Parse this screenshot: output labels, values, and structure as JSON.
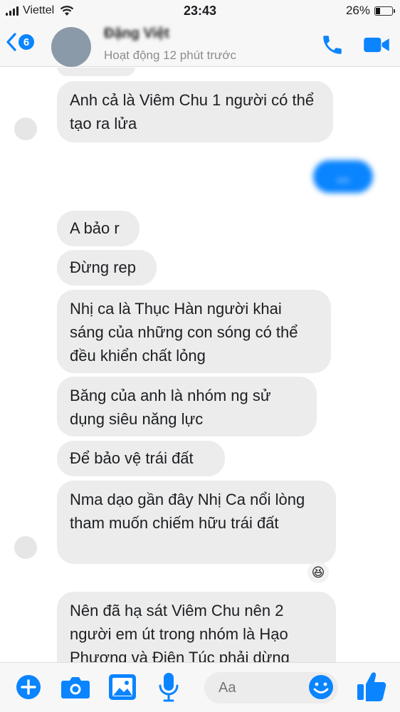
{
  "status_bar": {
    "carrier": "Viettel",
    "time": "23:43",
    "battery": "26%"
  },
  "header": {
    "back_count": "6",
    "contact_name": "Đặng Việt",
    "activity": "Hoạt động 12 phút trước"
  },
  "messages": [
    {
      "from": "them",
      "text": "Anh cả là Viêm Chu 1 người có thể tạo ra lửa"
    },
    {
      "from": "me",
      "text": "..."
    },
    {
      "from": "them",
      "text": "A bảo r"
    },
    {
      "from": "them",
      "text": "Đừng rep"
    },
    {
      "from": "them",
      "text": "Nhị ca là Thục Hàn người khai sáng của những con sóng có thể đều khiển chất lỏng"
    },
    {
      "from": "them",
      "text": "Băng của anh là nhóm ng sử dụng siêu năng lực"
    },
    {
      "from": "them",
      "text": "Để bảo vệ trái đất"
    },
    {
      "from": "them",
      "text": "Nma dạo gần đây Nhị Ca nổi lòng tham muốn chiếm hữu trái đất"
    },
    {
      "from": "them",
      "text": "Nên đã hạ sát Viêm Chu nên 2 người em út trong nhóm là Hạo Phương và Điện Túc phải dừng"
    }
  ],
  "reaction": "😆",
  "composer": {
    "placeholder": "Aa"
  },
  "colors": {
    "accent": "#0a84ff",
    "incoming_bubble": "#ececec"
  },
  "icons": [
    "plus-icon",
    "camera-icon",
    "image-icon",
    "microphone-icon",
    "emoji-icon",
    "thumbs-up-icon",
    "phone-icon",
    "video-icon",
    "back-chevron-icon"
  ]
}
